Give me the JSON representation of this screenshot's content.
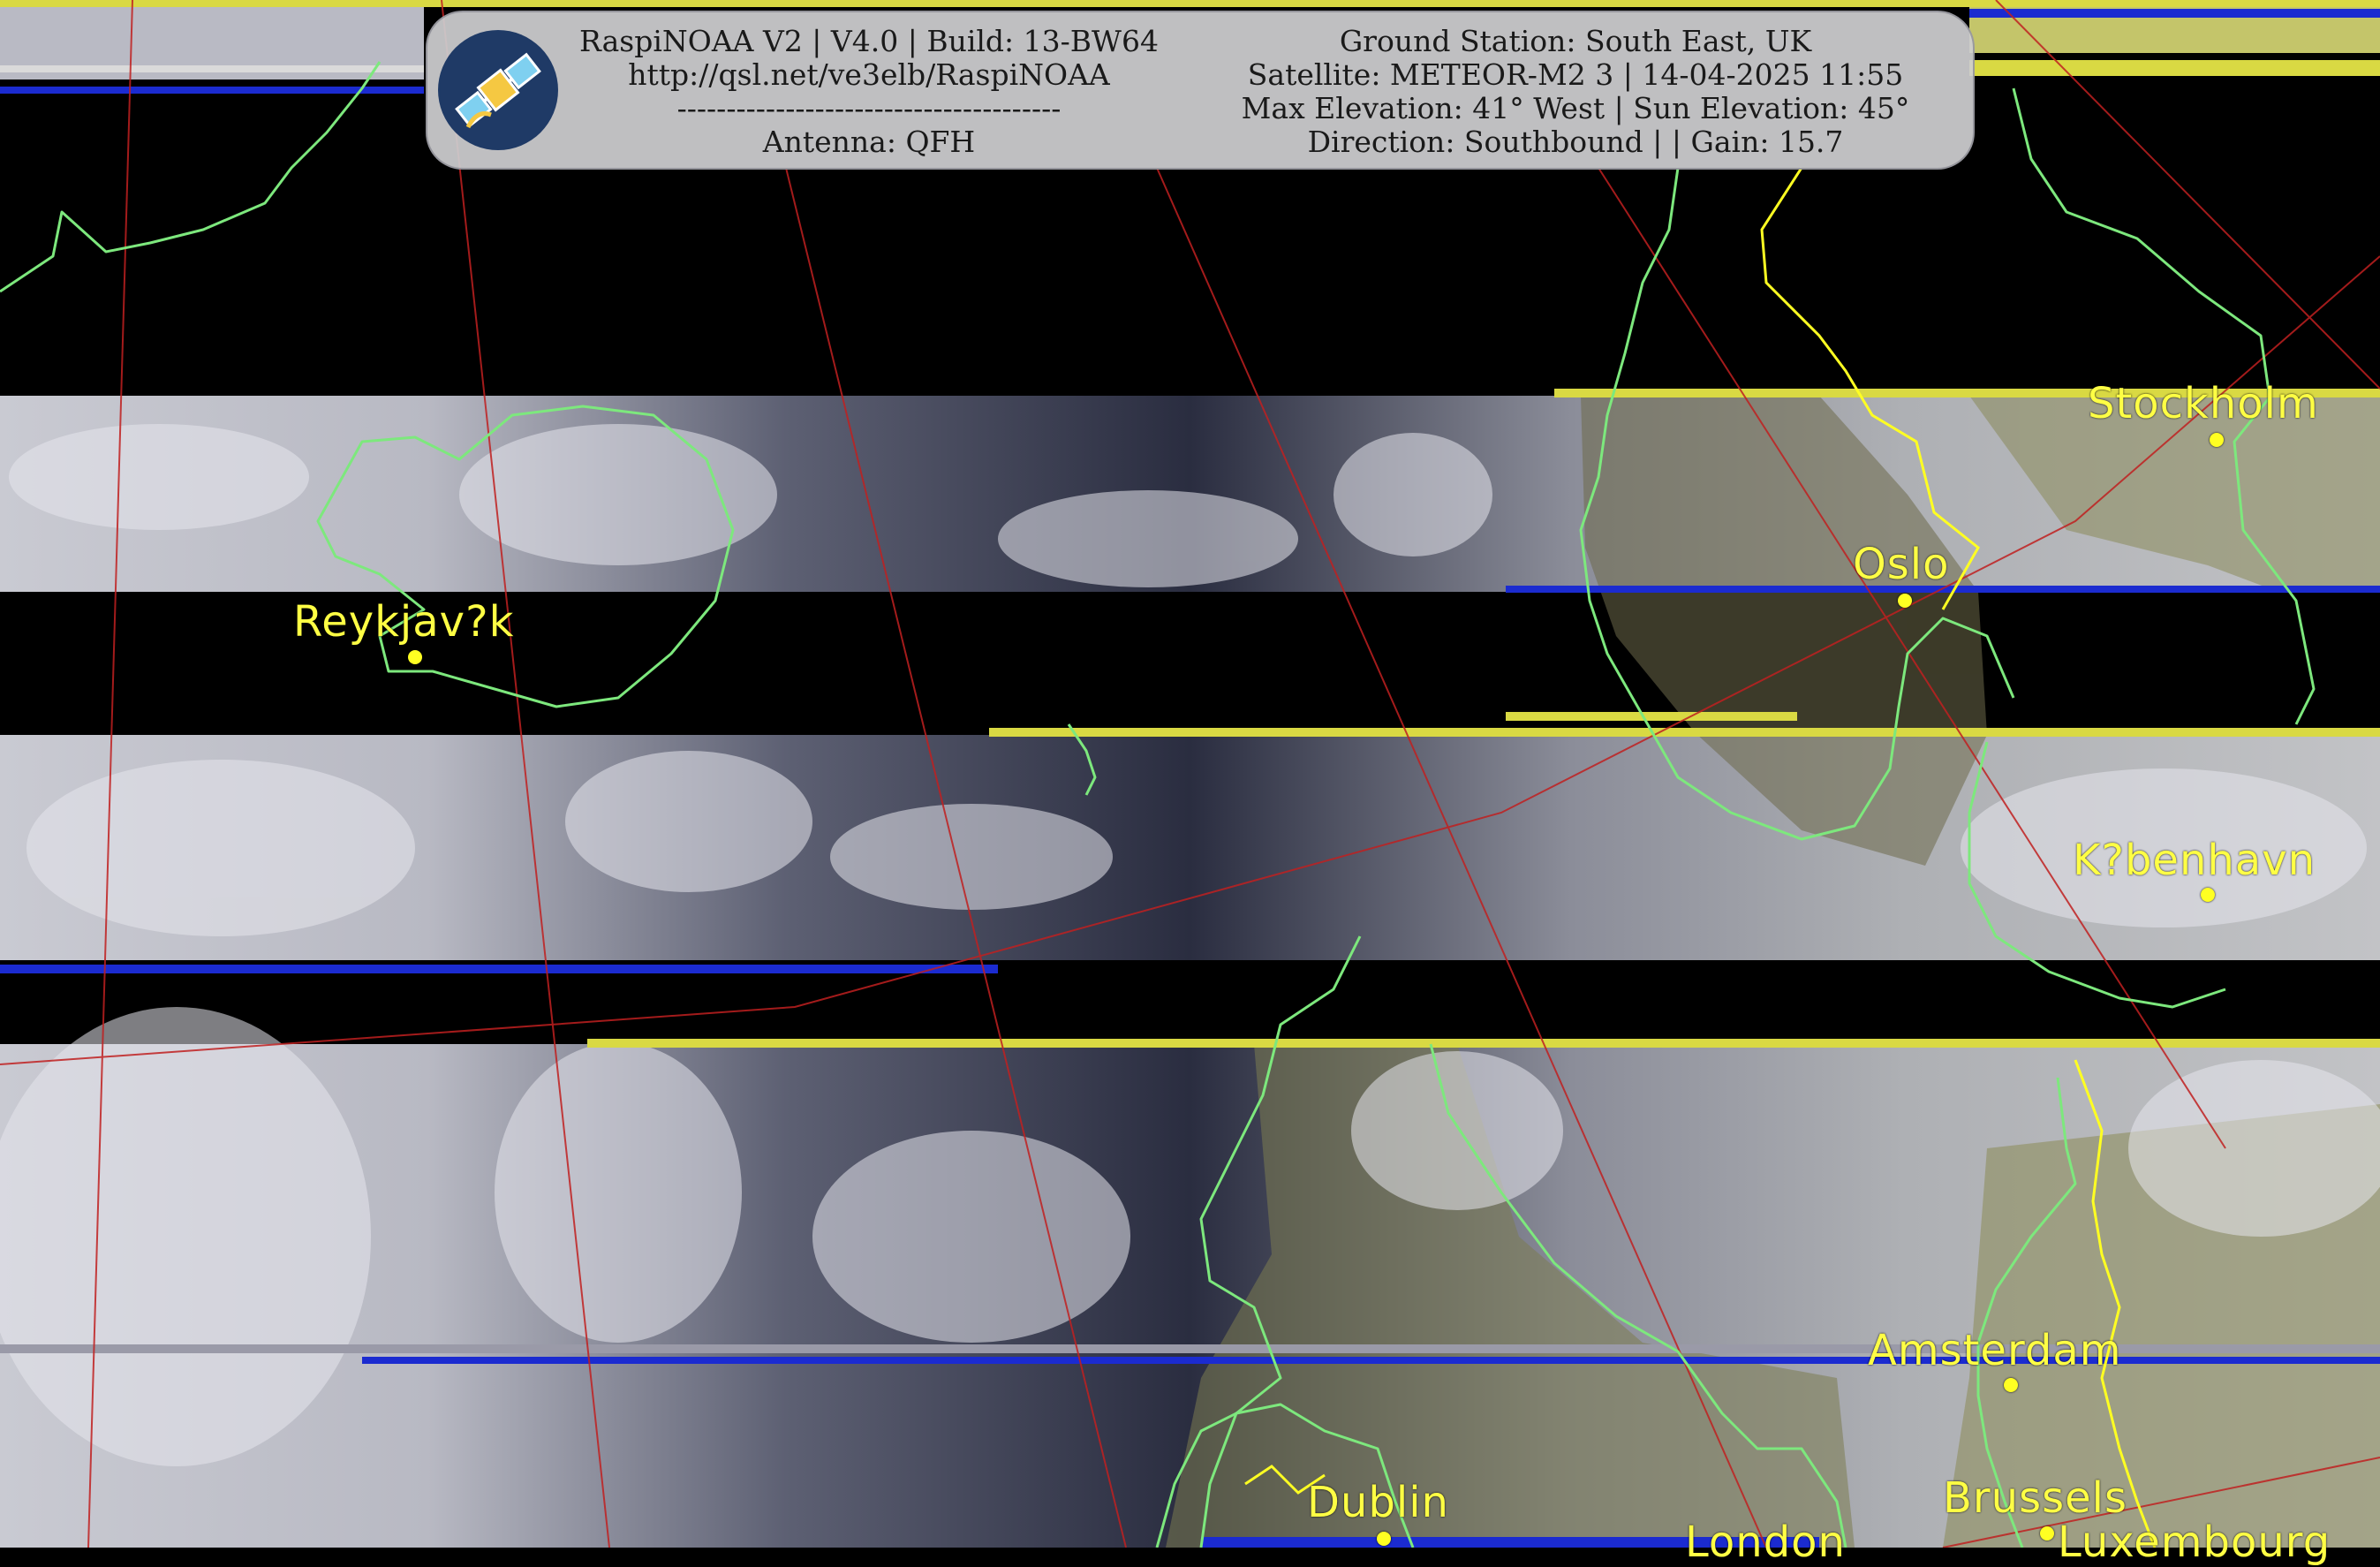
{
  "header": {
    "left": {
      "line1": "RaspiNOAA V2 | V4.0 | Build: 13-BW64",
      "line2": "http://qsl.net/ve3elb/RaspiNOAA",
      "line3": "---------------------------------------",
      "line4": "Antenna: QFH"
    },
    "right": {
      "line1": "Ground Station: South East, UK",
      "line2": "Satellite: METEOR-M2 3 | 14-04-2025 11:55",
      "line3": "Max Elevation: 41° West | Sun Elevation: 45°",
      "line4": "Direction: Southbound | | Gain: 15.7"
    }
  },
  "logo": {
    "icon": "satellite-icon"
  },
  "cities": {
    "stockholm": "Stockholm",
    "oslo": "Oslo",
    "reykjavik": "Reykjav?k",
    "kobenhavn": "K?benhavn",
    "amsterdam": "Amsterdam",
    "dublin": "Dublin",
    "london": "London",
    "brussels": "Brussels",
    "luxembourg": "Luxembourg"
  },
  "colors": {
    "city_label": "#ffff44",
    "coastline": "#7de87d",
    "border": "#ffff22",
    "graticule": "#c02020",
    "panel": "#cdcdd0",
    "ocean": "#1a1d30"
  }
}
